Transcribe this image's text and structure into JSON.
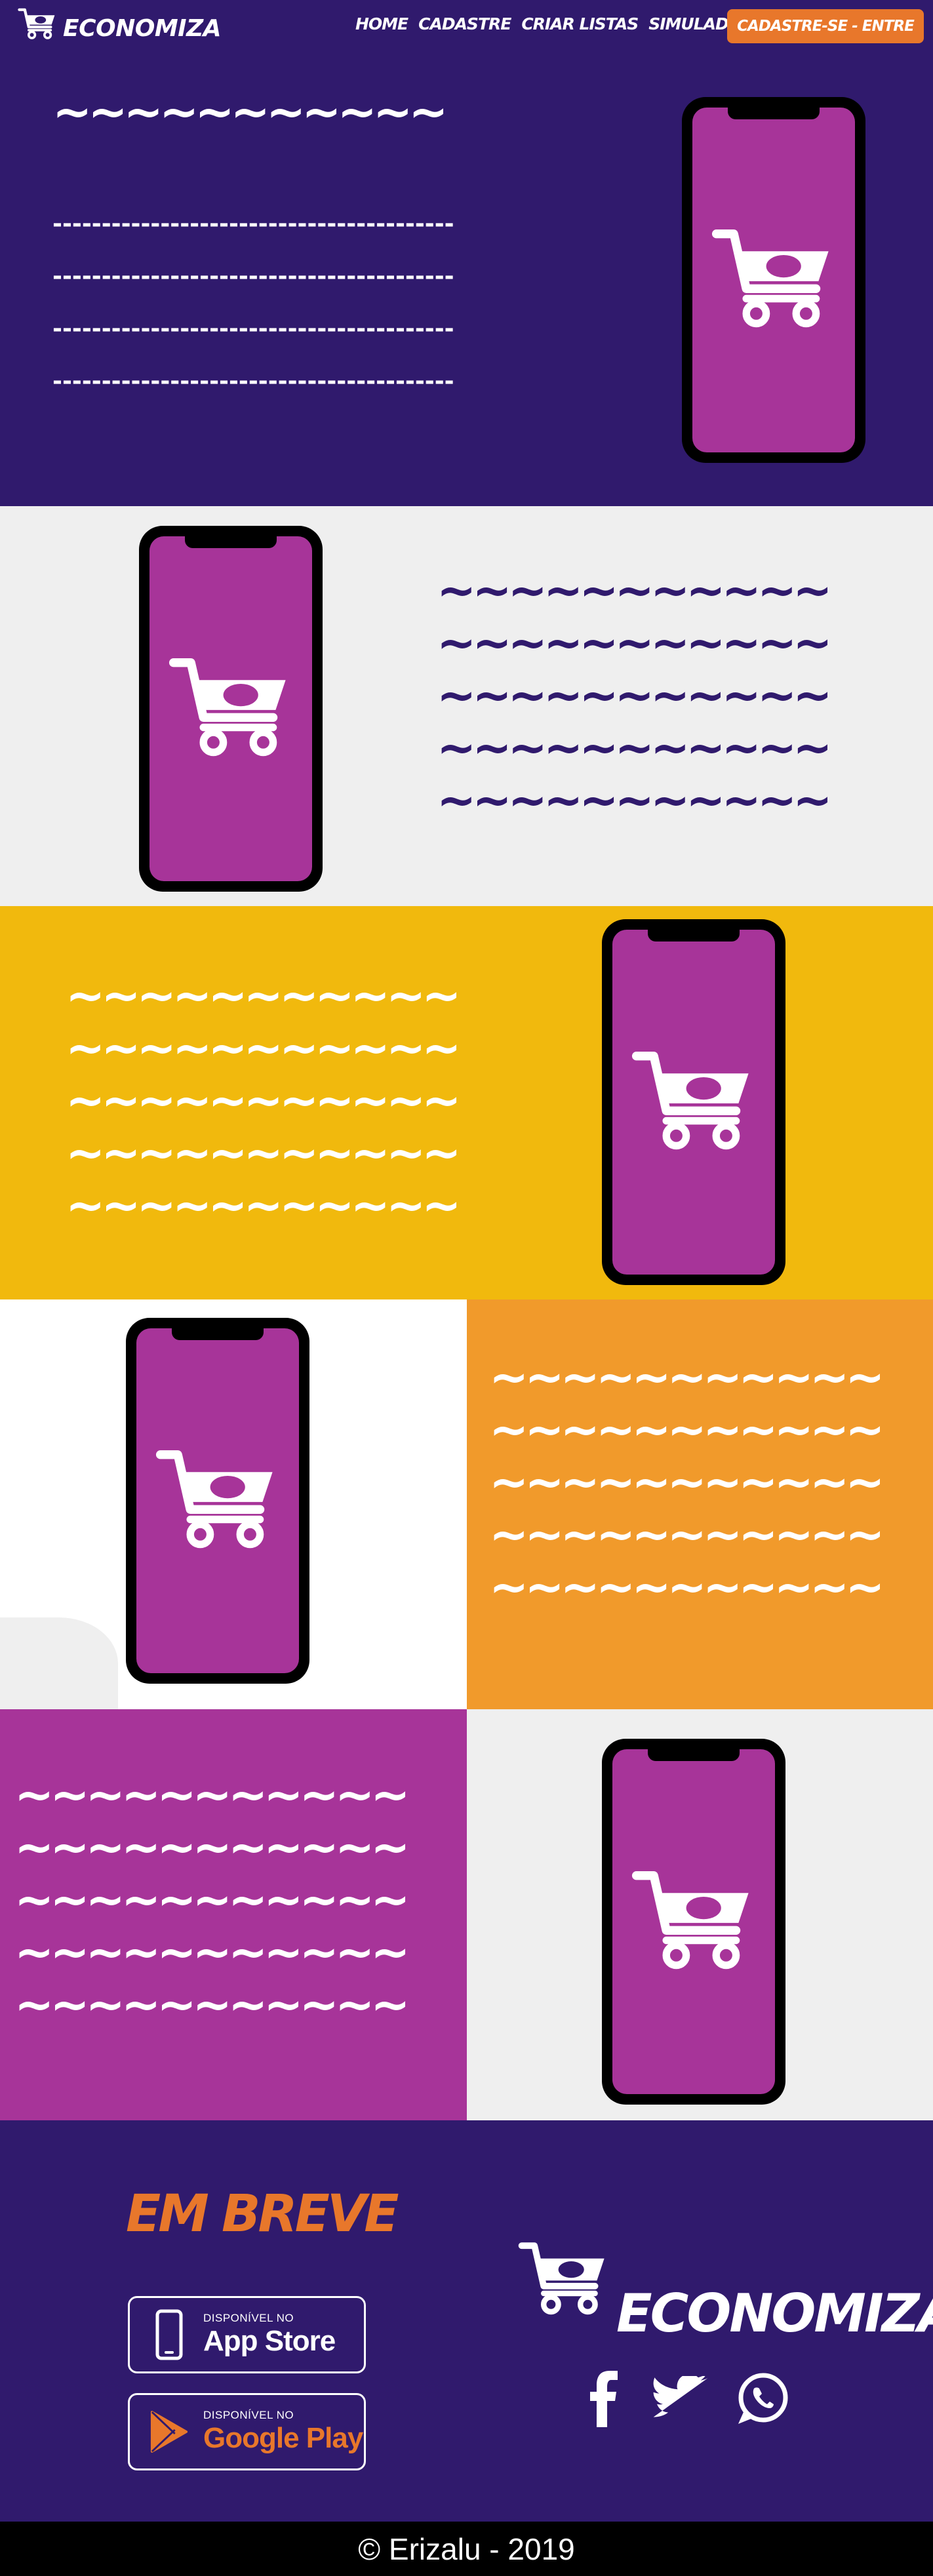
{
  "brand": {
    "name": "ECONOMIZA"
  },
  "nav": {
    "links": [
      {
        "label": "HOME"
      },
      {
        "label": "CADASTRE"
      },
      {
        "label": "CRIAR LISTAS"
      },
      {
        "label": "SIMULADOR"
      }
    ],
    "cta_label": "CADASTRE-SE - ENTRE"
  },
  "hero": {
    "headline": "~~~~~~~~~~~",
    "lines": [
      "-----------------------------------------",
      "-----------------------------------------",
      "-----------------------------------------",
      "-----------------------------------------"
    ]
  },
  "section2": {
    "lines": [
      "~~~~~~~~~~~",
      "~~~~~~~~~~~",
      "~~~~~~~~~~~",
      "~~~~~~~~~~~",
      "~~~~~~~~~~~"
    ]
  },
  "section3": {
    "lines": [
      "~~~~~~~~~~~",
      "~~~~~~~~~~~",
      "~~~~~~~~~~~",
      "~~~~~~~~~~~",
      "~~~~~~~~~~~"
    ]
  },
  "section4": {
    "lines": [
      "~~~~~~~~~~~",
      "~~~~~~~~~~~",
      "~~~~~~~~~~~",
      "~~~~~~~~~~~",
      "~~~~~~~~~~~"
    ]
  },
  "section5": {
    "lines": [
      "~~~~~~~~~~~",
      "~~~~~~~~~~~",
      "~~~~~~~~~~~",
      "~~~~~~~~~~~",
      "~~~~~~~~~~~"
    ]
  },
  "footer": {
    "coming_soon": "EM BREVE",
    "app_store": {
      "small": "DISPONÍVEL NO",
      "big": "App Store"
    },
    "google_play": {
      "small": "DISPONÍVEL NO",
      "big": "Google Play"
    },
    "logo_text": "ECONOMIZA",
    "social_icons": [
      "facebook-icon",
      "twitter-icon",
      "whatsapp-icon"
    ]
  },
  "copyright": "© Erizalu - 2019",
  "colors": {
    "deep_purple": "#301a6d",
    "magenta": "#a73499",
    "yellow": "#f1b90d",
    "orange": "#f19a2b",
    "accent_orange": "#e8772b",
    "light_gray": "#efefef"
  }
}
